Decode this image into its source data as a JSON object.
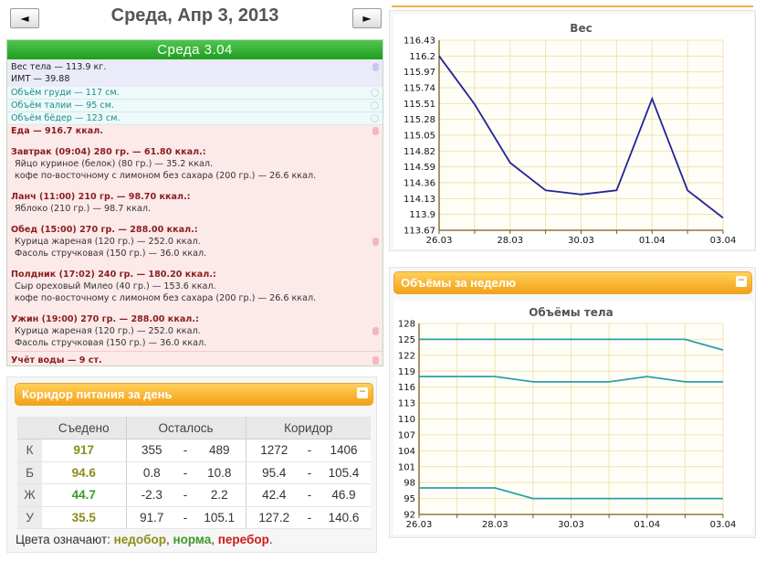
{
  "nav": {
    "prev_label": "◄",
    "next_label": "►",
    "date_title": "Среда, Апр 3, 2013"
  },
  "diary": {
    "header": "Среда 3.04",
    "weight_line": "Вес тела — 113.9 кг.",
    "bmi_line": "ИМТ — 39.88",
    "measurements": [
      "Объём груди — 117 см.",
      "Объём талии — 95 см.",
      "Объём бёдер — 123 см."
    ],
    "food_total": "Еда — 916.7 ккал.",
    "meals": [
      {
        "title": "Завтрак (09:04) 280 гр. — 61.80 ккал.:",
        "items": [
          "Яйцо куриное (белок) (80 гр.) — 35.2 ккал.",
          "кофе по-восточному с лимоном без сахара (200 гр.) — 26.6 ккал."
        ]
      },
      {
        "title": "Ланч (11:00) 210 гр. — 98.70 ккал.:",
        "items": [
          "Яблоко (210 гр.) — 98.7 ккал."
        ]
      },
      {
        "title": "Обед (15:00) 270 гр. — 288.00 ккал.:",
        "items": [
          "Курица жареная (120 гр.) — 252.0 ккал.",
          "Фасоль стручковая (150 гр.) — 36.0 ккал."
        ]
      },
      {
        "title": "Полдник (17:02) 240 гр. — 180.20 ккал.:",
        "items": [
          "Сыр ореховый Милео (40 гр.) — 153.6 ккал.",
          "кофе по-восточному с лимоном без сахара (200 гр.) — 26.6 ккал."
        ]
      },
      {
        "title": "Ужин (19:00) 270 гр. — 288.00 ккал.:",
        "items": [
          "Курица жареная (120 гр.) — 252.0 ккал.",
          "Фасоль стручковая (150 гр.) — 36.0 ккал."
        ]
      }
    ],
    "water_line": "Учёт воды — 9 ст."
  },
  "corridor": {
    "title": "Коридор питания за день",
    "minimize_label": "−",
    "headers": [
      "Съедено",
      "Осталось",
      "Коридор"
    ],
    "rows": [
      {
        "label": "К",
        "eaten": "917",
        "left_min": "355",
        "left_max": "489",
        "corr_min": "1272",
        "corr_max": "1406",
        "status": "under"
      },
      {
        "label": "Б",
        "eaten": "94.6",
        "left_min": "0.8",
        "left_max": "10.8",
        "corr_min": "95.4",
        "corr_max": "105.4",
        "status": "under"
      },
      {
        "label": "Ж",
        "eaten": "44.7",
        "left_min": "-2.3",
        "left_max": "2.2",
        "corr_min": "42.4",
        "corr_max": "46.9",
        "status": "norm"
      },
      {
        "label": "У",
        "eaten": "35.5",
        "left_min": "91.7",
        "left_max": "105.1",
        "corr_min": "127.2",
        "corr_max": "140.6",
        "status": "under"
      }
    ],
    "dash": "-",
    "legend_prefix": "Цвета означают: ",
    "legend_under": "недобор",
    "legend_norm": "норма",
    "legend_over": "перебор",
    "colors": {
      "under": "#8c8c1a",
      "norm": "#3c9a2a",
      "over": "#cc1a1a"
    }
  },
  "volumes_panel": {
    "title": "Объёмы за неделю",
    "minimize_label": "−"
  },
  "chart_data": [
    {
      "type": "line",
      "title": "Вес",
      "x": [
        "26.03",
        "27.03",
        "28.03",
        "29.03",
        "30.03",
        "31.03",
        "01.04",
        "02.04",
        "03.04"
      ],
      "x_tick_labels": [
        "26.03",
        "28.03",
        "30.03",
        "01.04",
        "03.04"
      ],
      "series": [
        {
          "values": [
            116.2,
            115.5,
            114.65,
            114.25,
            114.19,
            114.25,
            115.58,
            114.25,
            113.85
          ],
          "color": "#22229a"
        }
      ],
      "y_ticks": [
        "113.67",
        "113.9",
        "114.13",
        "114.36",
        "114.59",
        "114.82",
        "115.05",
        "115.28",
        "115.51",
        "115.74",
        "115.97",
        "116.2",
        "116.43"
      ],
      "ylim": [
        113.67,
        116.43
      ],
      "grid": true,
      "xlabel": "",
      "ylabel": ""
    },
    {
      "type": "line",
      "title": "Объёмы тела",
      "x": [
        "26.03",
        "27.03",
        "28.03",
        "29.03",
        "30.03",
        "31.03",
        "01.04",
        "02.04",
        "03.04"
      ],
      "x_tick_labels": [
        "26.03",
        "28.03",
        "30.03",
        "01.04",
        "03.04"
      ],
      "series": [
        {
          "values": [
            125,
            125,
            125,
            125,
            125,
            125,
            125,
            125,
            123
          ],
          "color": "#2aa0a8"
        },
        {
          "values": [
            118,
            118,
            118,
            117,
            117,
            117,
            118,
            117,
            117
          ],
          "color": "#2aa0a8"
        },
        {
          "values": [
            97,
            97,
            97,
            95,
            95,
            95,
            95,
            95,
            95
          ],
          "color": "#2aa0a8"
        }
      ],
      "y_ticks": [
        "92",
        "95",
        "98",
        "101",
        "104",
        "107",
        "110",
        "113",
        "116",
        "119",
        "122",
        "125",
        "128"
      ],
      "ylim": [
        92,
        128
      ],
      "grid": true,
      "xlabel": "",
      "ylabel": ""
    }
  ]
}
